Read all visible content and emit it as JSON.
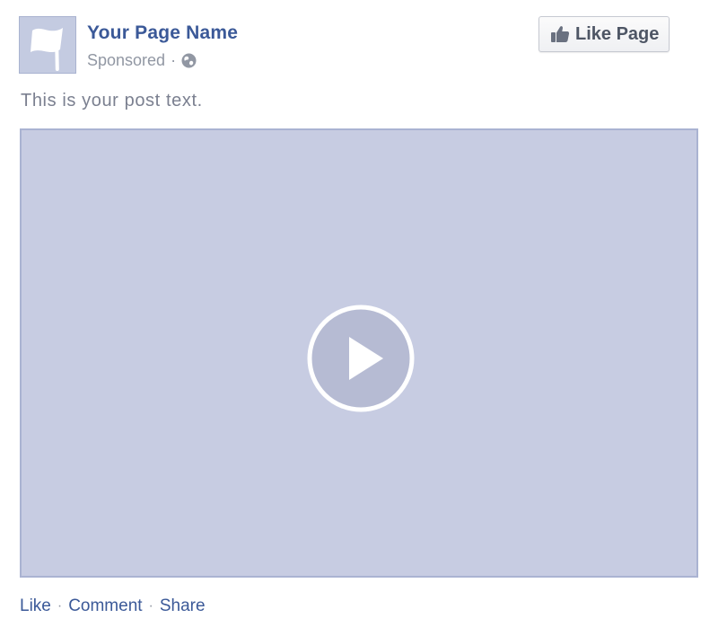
{
  "post": {
    "page_name": "Your Page Name",
    "sponsored_label": "Sponsored",
    "meta_separator": "·",
    "audience_icon": "globe-icon",
    "avatar_icon": "flag-icon",
    "text": "This is your post text."
  },
  "like_button": {
    "label": "Like Page",
    "icon": "thumbs-up-icon"
  },
  "video": {
    "icon": "play-icon",
    "background_color": "#c7cce2"
  },
  "actions": {
    "like": "Like",
    "comment": "Comment",
    "share": "Share",
    "separator": "·"
  },
  "colors": {
    "link": "#3b5998",
    "muted": "#9197a3",
    "button_text": "#4e5665"
  }
}
